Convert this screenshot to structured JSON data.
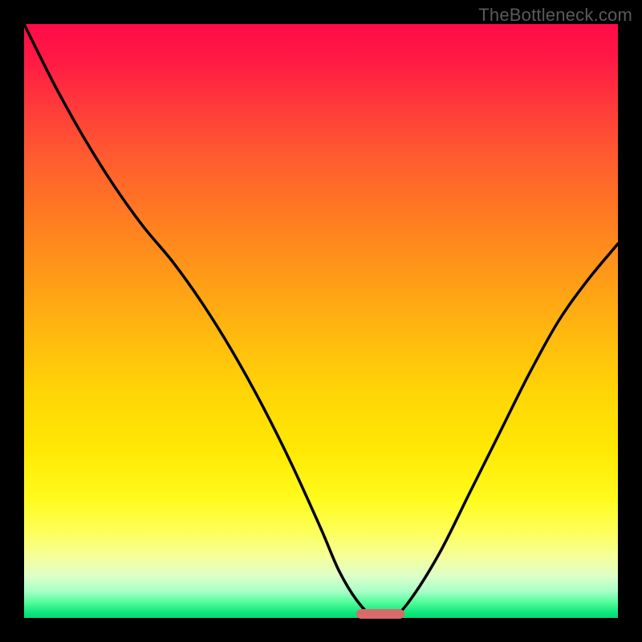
{
  "watermark": "TheBottleneck.com",
  "colors": {
    "background": "#000000",
    "marker": "#d86a6a",
    "curve": "#000000"
  },
  "chart_data": {
    "type": "line",
    "title": "",
    "xlabel": "",
    "ylabel": "",
    "xlim": [
      0,
      100
    ],
    "ylim": [
      0,
      100
    ],
    "grid": false,
    "series": [
      {
        "name": "bottleneck-curve",
        "x": [
          0,
          5,
          10,
          15,
          20,
          25,
          30,
          35,
          40,
          45,
          50,
          53,
          56,
          59,
          62,
          65,
          70,
          75,
          80,
          85,
          90,
          95,
          100
        ],
        "y": [
          100,
          90,
          81,
          73,
          66,
          60,
          53,
          45,
          36,
          26,
          15,
          8,
          3,
          0,
          0,
          3,
          11,
          21,
          31,
          41,
          50,
          57,
          63
        ]
      }
    ],
    "marker": {
      "x_start": 56,
      "x_end": 64,
      "y": 0
    }
  }
}
